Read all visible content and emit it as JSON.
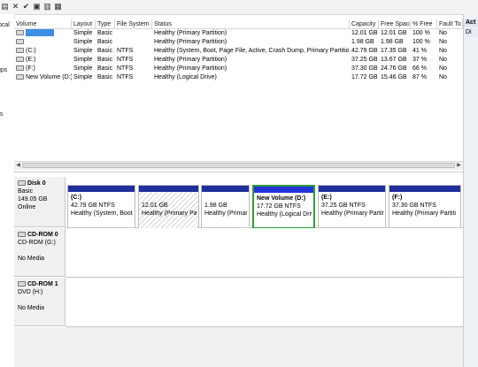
{
  "left_nav": {
    "items": [
      "ocal",
      "ups",
      "ns"
    ]
  },
  "actions": {
    "header": "Act",
    "sub": "Di"
  },
  "volume_table": {
    "headers": [
      "Volume",
      "Layout",
      "Type",
      "File System",
      "Status",
      "Capacity",
      "Free Space",
      "% Free",
      "Fault To"
    ],
    "rows": [
      {
        "volume": "",
        "layout": "Simple",
        "type": "Basic",
        "fs": "",
        "status": "Healthy (Primary Partition)",
        "capacity": "12.01 GB",
        "free": "12.01 GB",
        "pct": "100 %",
        "fault": "No",
        "selected": true
      },
      {
        "volume": "",
        "layout": "Simple",
        "type": "Basic",
        "fs": "",
        "status": "Healthy (Primary Partition)",
        "capacity": "1.98 GB",
        "free": "1.98 GB",
        "pct": "100 %",
        "fault": "No",
        "selected": false
      },
      {
        "volume": "(C:)",
        "layout": "Simple",
        "type": "Basic",
        "fs": "NTFS",
        "status": "Healthy (System, Boot, Page File, Active, Crash Dump, Primary Partition)",
        "capacity": "42.79 GB",
        "free": "17.35 GB",
        "pct": "41 %",
        "fault": "No",
        "selected": false
      },
      {
        "volume": "(E:)",
        "layout": "Simple",
        "type": "Basic",
        "fs": "NTFS",
        "status": "Healthy (Primary Partition)",
        "capacity": "37.25 GB",
        "free": "13.67 GB",
        "pct": "37 %",
        "fault": "No",
        "selected": false
      },
      {
        "volume": "(F:)",
        "layout": "Simple",
        "type": "Basic",
        "fs": "NTFS",
        "status": "Healthy (Primary Partition)",
        "capacity": "37.30 GB",
        "free": "24.76 GB",
        "pct": "66 %",
        "fault": "No",
        "selected": false
      },
      {
        "volume": "New Volume (D:)",
        "layout": "Simple",
        "type": "Basic",
        "fs": "NTFS",
        "status": "Healthy (Logical Drive)",
        "capacity": "17.72 GB",
        "free": "15.46 GB",
        "pct": "87 %",
        "fault": "No",
        "selected": false
      }
    ]
  },
  "disks": [
    {
      "name": "Disk 0",
      "type": "Basic",
      "size": "149.05 GB",
      "state": "Online"
    },
    {
      "name": "CD-ROM 0",
      "type": "CD-ROM (G:)",
      "size": "",
      "state": "No Media"
    },
    {
      "name": "CD-ROM 1",
      "type": "DVD (H:)",
      "size": "",
      "state": "No Media"
    }
  ],
  "partitions": [
    {
      "title": "(C:)",
      "size": "42.79 GB NTFS",
      "status": "Healthy (System, Boot, P"
    },
    {
      "title": "",
      "size": "12.01 GB",
      "status": "Healthy (Primary Par"
    },
    {
      "title": "",
      "size": "1.98 GB",
      "status": "Healthy (Primar"
    },
    {
      "title": "New Volume  (D:)",
      "size": "17.72 GB NTFS",
      "status": "Healthy (Logical Driv"
    },
    {
      "title": "(E:)",
      "size": "37.25 GB NTFS",
      "status": "Healthy (Primary Partiti"
    },
    {
      "title": "(F:)",
      "size": "37.30 GB NTFS",
      "status": "Healthy (Primary Partiti"
    }
  ],
  "colors": {
    "primary_bar": "#1f2f9c",
    "logical_border": "#2e9b3a",
    "selection": "#3d8ee6"
  }
}
